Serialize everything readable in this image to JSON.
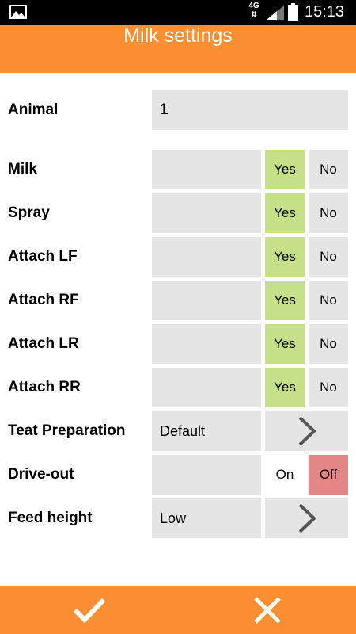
{
  "status_bar": {
    "network": "4G",
    "time": "15:13",
    "icons": [
      "image-icon",
      "signal-icon",
      "battery-icon"
    ]
  },
  "title": "Milk settings",
  "animal": {
    "label": "Animal",
    "value": "1"
  },
  "toggles": [
    {
      "label": "Milk",
      "yes": "Yes",
      "no": "No",
      "selected": "Yes"
    },
    {
      "label": "Spray",
      "yes": "Yes",
      "no": "No",
      "selected": "Yes"
    },
    {
      "label": "Attach LF",
      "yes": "Yes",
      "no": "No",
      "selected": "Yes"
    },
    {
      "label": "Attach RF",
      "yes": "Yes",
      "no": "No",
      "selected": "Yes"
    },
    {
      "label": "Attach LR",
      "yes": "Yes",
      "no": "No",
      "selected": "Yes"
    },
    {
      "label": "Attach RR",
      "yes": "Yes",
      "no": "No",
      "selected": "Yes"
    }
  ],
  "teat_preparation": {
    "label": "Teat Preparation",
    "value": "Default"
  },
  "drive_out": {
    "label": "Drive-out",
    "on": "On",
    "off": "Off",
    "selected": "Off"
  },
  "feed_height": {
    "label": "Feed height",
    "value": "Low"
  },
  "bottom_bar": {
    "confirm_icon": "checkmark-icon",
    "cancel_icon": "close-icon"
  },
  "colors": {
    "accent": "#f98e33",
    "yes_selected": "#c6e08a",
    "off_selected": "#e38686",
    "cell": "#e5e5e5"
  }
}
